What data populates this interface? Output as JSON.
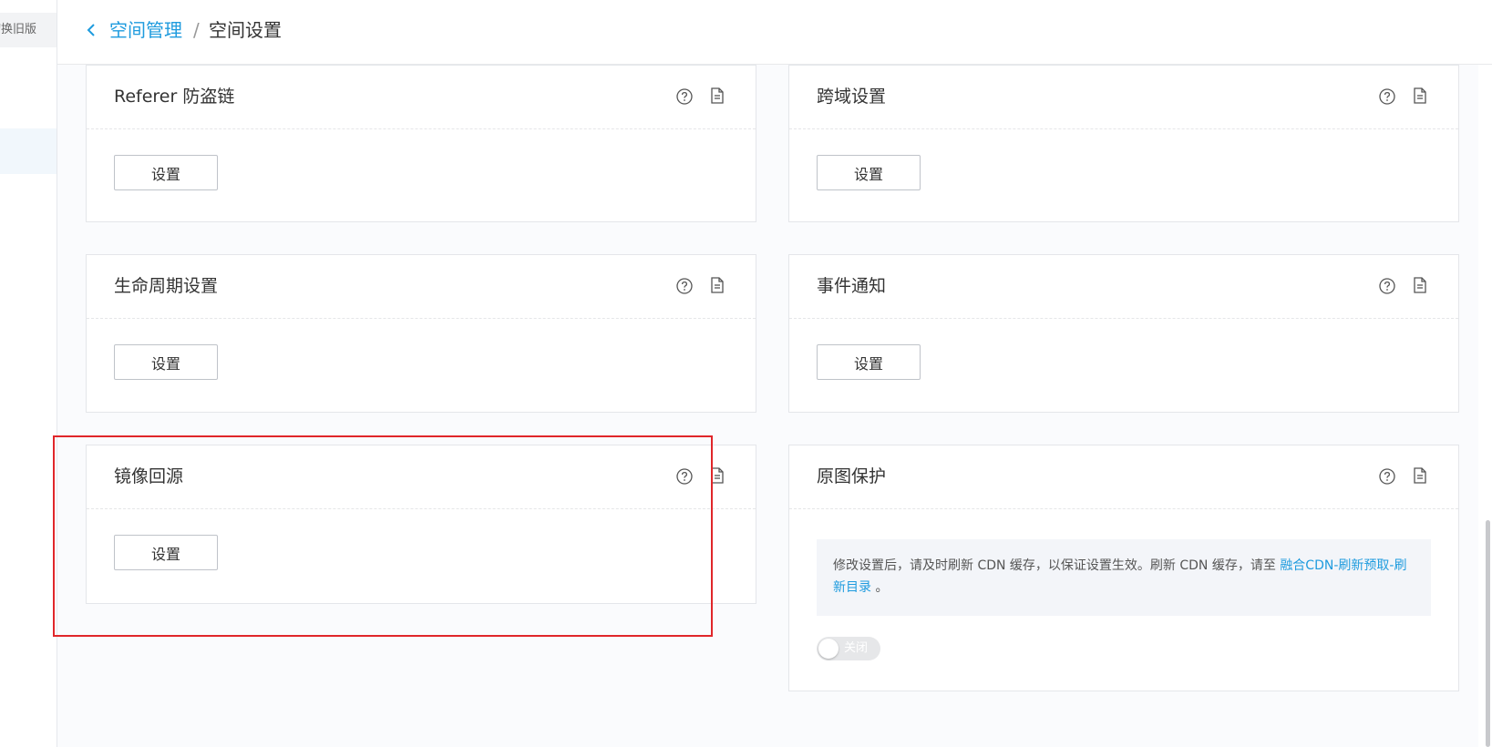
{
  "sidebar": {
    "switch_label": "切换旧版"
  },
  "breadcrumb": {
    "back_icon": "chevron-left-icon",
    "parent": "空间管理",
    "separator": "/",
    "current": "空间设置"
  },
  "cards": {
    "referer": {
      "title": "Referer 防盗链",
      "button": "设置"
    },
    "cors": {
      "title": "跨域设置",
      "button": "设置"
    },
    "lifecycle": {
      "title": "生命周期设置",
      "button": "设置"
    },
    "event": {
      "title": "事件通知",
      "button": "设置"
    },
    "mirror": {
      "title": "镜像回源",
      "button": "设置"
    },
    "original": {
      "title": "原图保护",
      "notice_text": "修改设置后，请及时刷新 CDN 缓存，以保证设置生效。刷新 CDN 缓存，请至",
      "notice_link": "融合CDN-刷新预取-刷新目录",
      "notice_end": "。",
      "toggle_label": "关闭",
      "toggle_on": false
    }
  },
  "icons": {
    "help": "help-circle-icon",
    "doc": "document-icon"
  },
  "colors": {
    "accent": "#1e9bde",
    "highlight": "#e0262a"
  }
}
